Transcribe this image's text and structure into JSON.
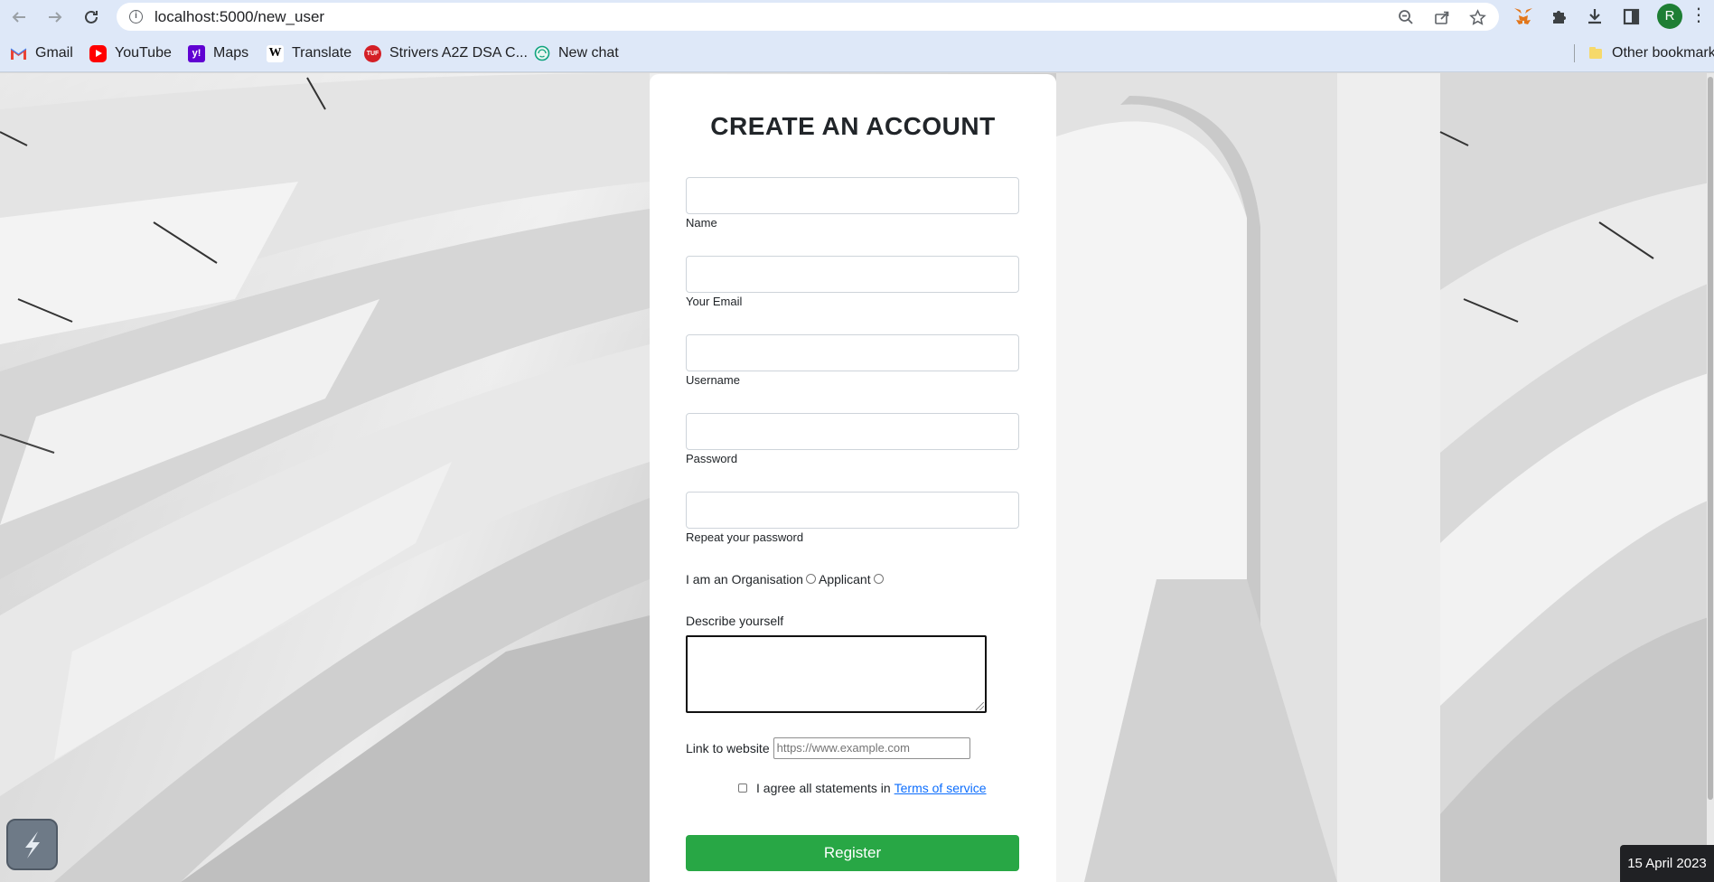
{
  "browser": {
    "url": "localhost:5000/new_user",
    "nav_icons": [
      "back-arrow-icon",
      "forward-arrow-icon",
      "reload-icon"
    ],
    "omnibox_icons": [
      "zoom-out-icon",
      "share-icon",
      "star-icon"
    ],
    "extension_icons": [
      "metamask-fox-icon",
      "puzzle-extensions-icon",
      "download-icon",
      "side-panel-icon"
    ],
    "profile_initial": "R",
    "bookmarks": [
      {
        "label": "Gmail",
        "icon": "gmail-icon"
      },
      {
        "label": "YouTube",
        "icon": "youtube-icon"
      },
      {
        "label": "Maps",
        "icon": "yahoo-icon"
      },
      {
        "label": "Translate",
        "icon": "wikipedia-icon"
      },
      {
        "label": "Strivers A2Z DSA C...",
        "icon": "tuf-icon"
      },
      {
        "label": "New chat",
        "icon": "chatgpt-icon"
      }
    ],
    "other_bookmarks": "Other bookmarks"
  },
  "form": {
    "title": "CREATE AN ACCOUNT",
    "fields": [
      {
        "label": "Name",
        "value": ""
      },
      {
        "label": "Your Email",
        "value": ""
      },
      {
        "label": "Username",
        "value": ""
      },
      {
        "label": "Password",
        "value": ""
      },
      {
        "label": "Repeat your password",
        "value": ""
      }
    ],
    "role_prompt": "I am an",
    "role_options": [
      "Organisation",
      "Applicant"
    ],
    "describe_label": "Describe yourself",
    "website_label": "Link to website",
    "website_placeholder": "https://www.example.com",
    "agree_text": "I agree all statements in",
    "terms_link": "Terms of service",
    "register_label": "Register"
  },
  "taskbar": {
    "date": "15 April 2023"
  },
  "colors": {
    "chrome_bg": "#dee8f8",
    "register_green": "#28a745",
    "link_blue": "#0d6efd",
    "avatar_green": "#1e7e34"
  }
}
